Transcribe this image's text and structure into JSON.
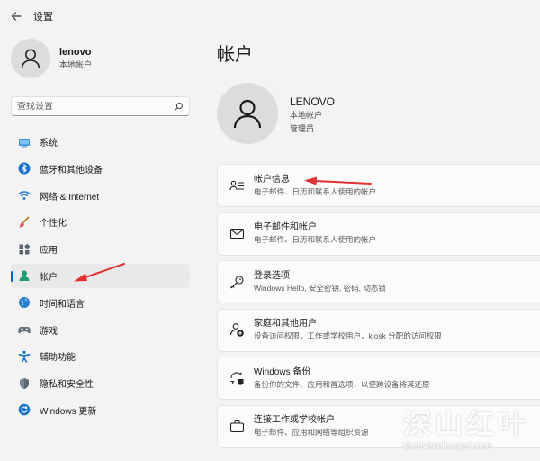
{
  "window": {
    "title": "设置"
  },
  "profile": {
    "name": "lenovo",
    "type": "本地帐户"
  },
  "search": {
    "placeholder": "查找设置"
  },
  "nav": {
    "items": [
      {
        "label": "系统",
        "icon": "system-icon"
      },
      {
        "label": "蓝牙和其他设备",
        "icon": "bluetooth-icon"
      },
      {
        "label": "网络 & Internet",
        "icon": "wifi-icon"
      },
      {
        "label": "个性化",
        "icon": "brush-icon"
      },
      {
        "label": "应用",
        "icon": "apps-icon"
      },
      {
        "label": "帐户",
        "icon": "account-icon",
        "active": true
      },
      {
        "label": "时间和语言",
        "icon": "globe-icon"
      },
      {
        "label": "游戏",
        "icon": "gamepad-icon"
      },
      {
        "label": "辅助功能",
        "icon": "accessibility-icon"
      },
      {
        "label": "隐私和安全性",
        "icon": "shield-icon"
      },
      {
        "label": "Windows 更新",
        "icon": "update-icon"
      }
    ]
  },
  "main": {
    "title": "帐户",
    "account": {
      "name": "LENOVO",
      "type": "本地帐户",
      "role": "管理员"
    },
    "cards": [
      {
        "title": "帐户信息",
        "desc": "电子邮件、日历和联系人使用的帐户",
        "icon": "account-info-icon"
      },
      {
        "title": "电子邮件和帐户",
        "desc": "电子邮件、日历和联系人使用的帐户",
        "icon": "mail-icon"
      },
      {
        "title": "登录选项",
        "desc": "Windows Hello, 安全密钥, 密码, 动态锁",
        "icon": "key-icon"
      },
      {
        "title": "家庭和其他用户",
        "desc": "设备访问权限，工作或学校用户，kiosk 分配的访问权限",
        "icon": "family-icon"
      },
      {
        "title": "Windows 备份",
        "desc": "备份你的文件、应用和首选项，以便跨设备将其还原",
        "icon": "backup-icon"
      },
      {
        "title": "连接工作或学校帐户",
        "desc": "电子邮件、应用和网络等组织资源",
        "icon": "briefcase-icon"
      }
    ]
  },
  "watermark": {
    "text": "深山红叶",
    "url": "shenshanhongye.com"
  },
  "colors": {
    "accent": "#0067c0",
    "annotation": "#e03232",
    "background": "#f3f3f3",
    "card": "#fbfbfb"
  }
}
